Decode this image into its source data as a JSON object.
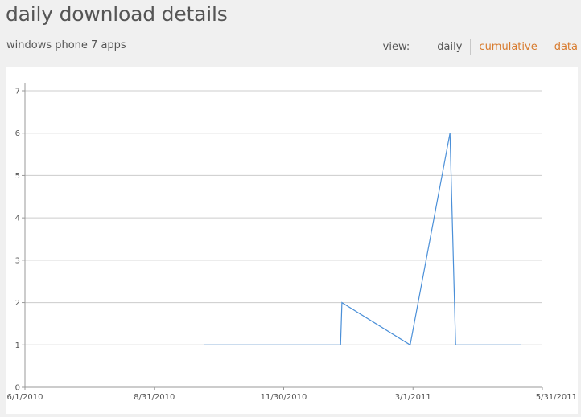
{
  "header": {
    "title": "daily download details",
    "subtitle": "windows phone 7 apps"
  },
  "view": {
    "label": "view:",
    "options": [
      {
        "label": "daily",
        "state": "selected"
      },
      {
        "label": "cumulative",
        "state": "link"
      },
      {
        "label": "data",
        "state": "link"
      }
    ]
  },
  "colors": {
    "line": "#4a8fd8",
    "gridline": "#cccccc",
    "link": "#d87b2e"
  },
  "chart_data": {
    "type": "line",
    "xaxis_ticks": [
      "6/1/2010",
      "8/31/2010",
      "11/30/2010",
      "3/1/2011",
      "5/31/2011"
    ],
    "yaxis_ticks": [
      0,
      1,
      2,
      3,
      4,
      5,
      6,
      7
    ],
    "ylim": [
      0,
      7
    ],
    "xlim": [
      "2010-06-01",
      "2011-05-31"
    ],
    "grid": true,
    "series": [
      {
        "points": [
          {
            "x": "2010-10-05",
            "y": 1
          },
          {
            "x": "2011-01-09",
            "y": 1
          },
          {
            "x": "2011-01-10",
            "y": 2
          },
          {
            "x": "2011-02-27",
            "y": 1
          },
          {
            "x": "2011-03-27",
            "y": 6
          },
          {
            "x": "2011-03-31",
            "y": 1
          },
          {
            "x": "2011-05-16",
            "y": 1
          }
        ]
      }
    ]
  }
}
